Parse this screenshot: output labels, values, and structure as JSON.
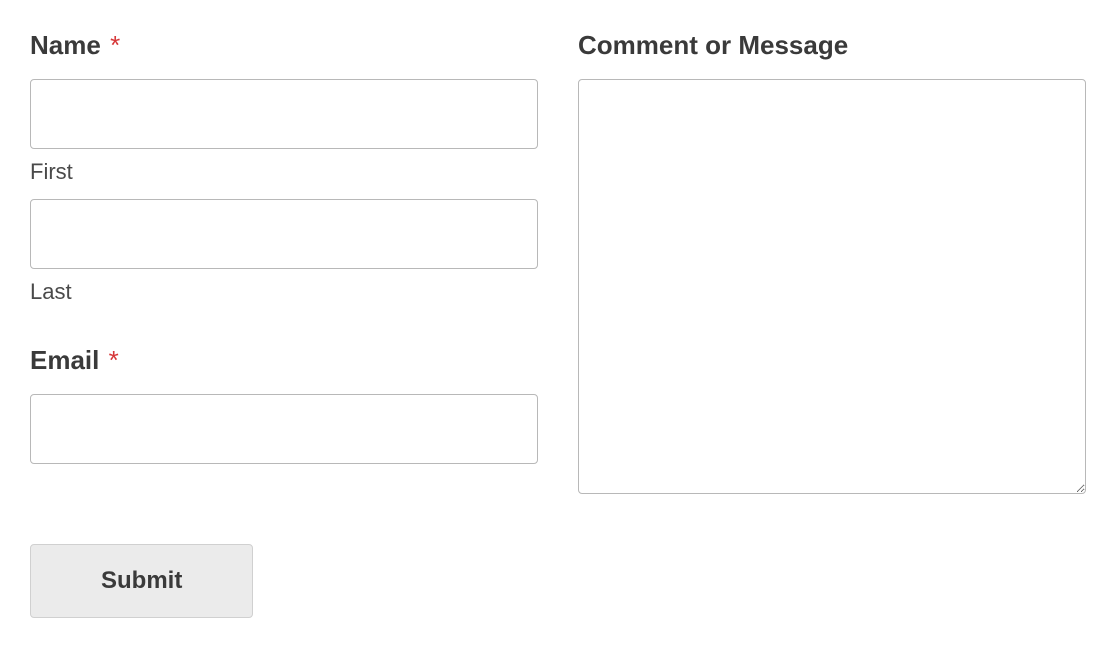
{
  "form": {
    "name": {
      "label": "Name",
      "required_marker": "*",
      "first": {
        "sublabel": "First",
        "value": ""
      },
      "last": {
        "sublabel": "Last",
        "value": ""
      }
    },
    "email": {
      "label": "Email",
      "required_marker": "*",
      "value": ""
    },
    "comment": {
      "label": "Comment or Message",
      "value": ""
    },
    "submit": {
      "label": "Submit"
    }
  }
}
